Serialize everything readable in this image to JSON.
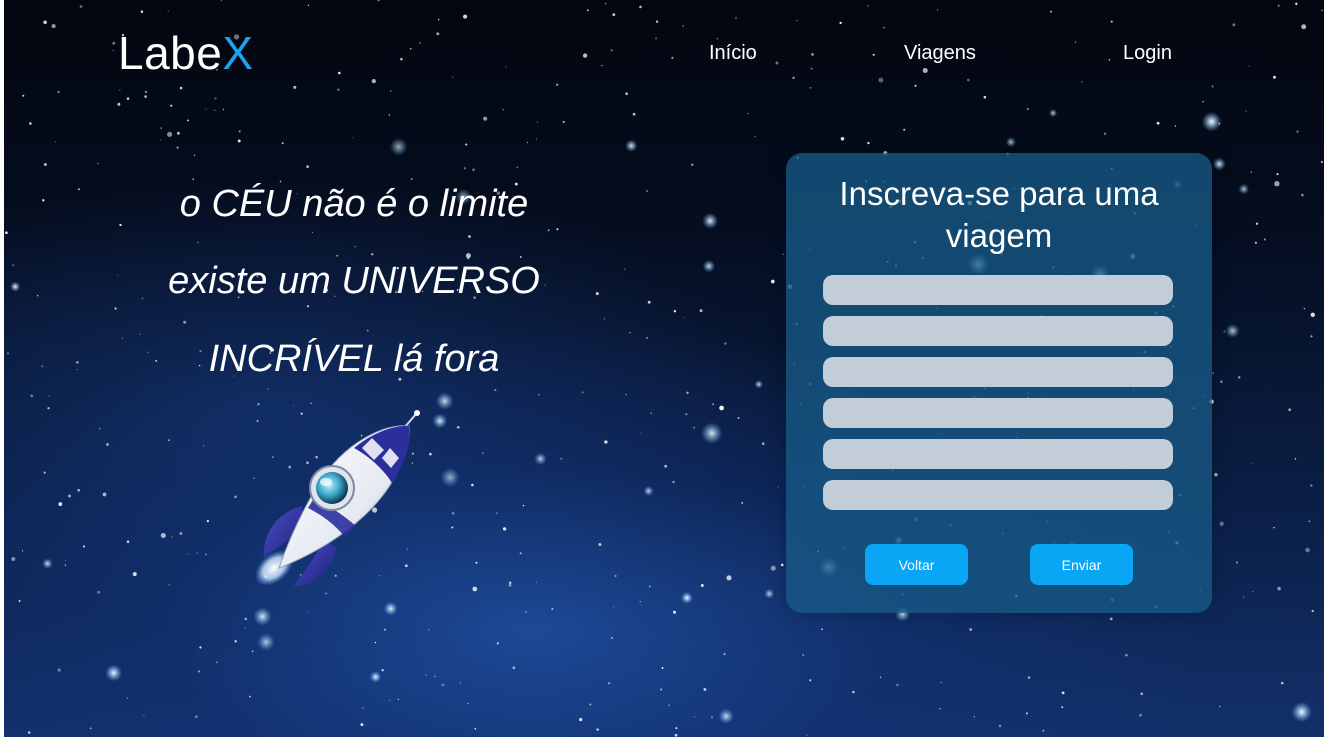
{
  "header": {
    "logo": {
      "main": "Labe",
      "accent": "X"
    },
    "nav": [
      {
        "label": "Início"
      },
      {
        "label": "Viagens"
      },
      {
        "label": "Login"
      }
    ]
  },
  "hero": {
    "lines": [
      "o CÉU não é o limite",
      "existe um UNIVERSO",
      "INCRÍVEL lá fora"
    ]
  },
  "form": {
    "title": "Inscreva-se para uma viagem",
    "fields": [
      {
        "value": "",
        "placeholder": ""
      },
      {
        "value": "",
        "placeholder": ""
      },
      {
        "value": "",
        "placeholder": ""
      },
      {
        "value": "",
        "placeholder": ""
      },
      {
        "value": "",
        "placeholder": ""
      },
      {
        "value": "",
        "placeholder": ""
      }
    ],
    "back_label": "Voltar",
    "submit_label": "Enviar"
  },
  "colors": {
    "accent": "#1aa3f0",
    "button": "#08a6f5",
    "card": "#175a87",
    "field": "#c2cdd8"
  }
}
